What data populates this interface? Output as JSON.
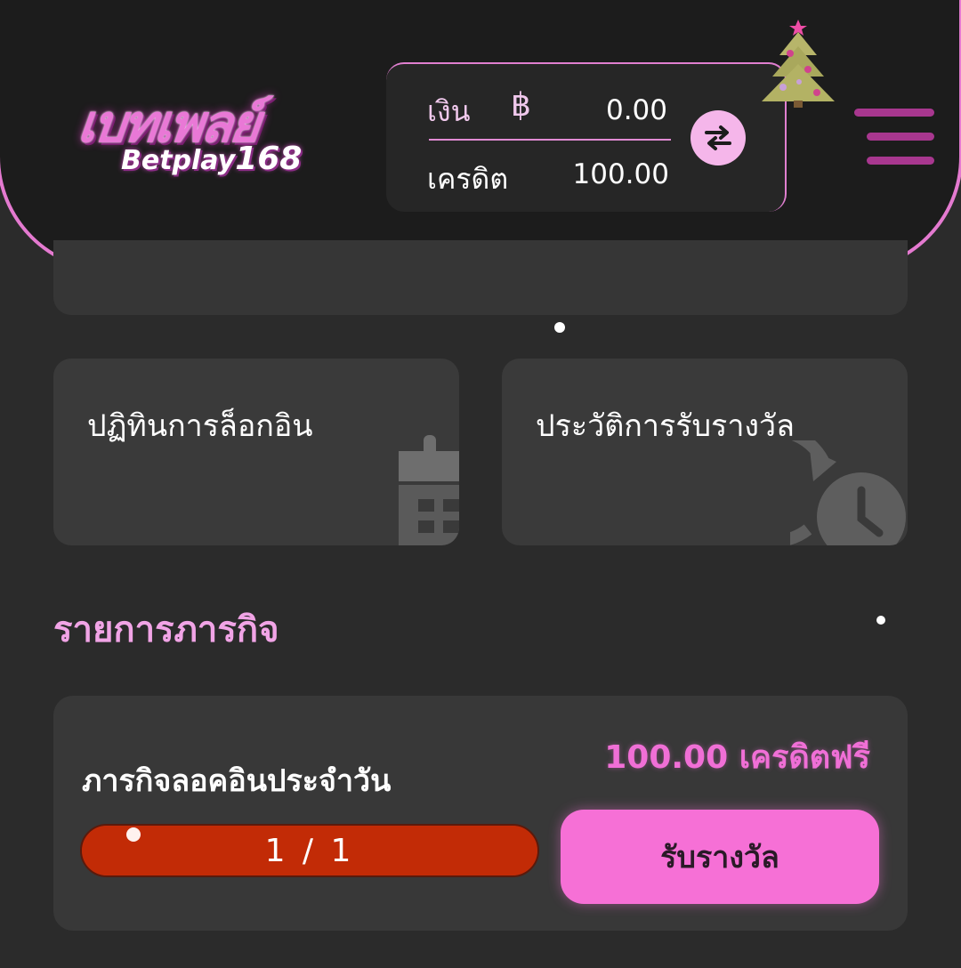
{
  "header": {
    "logo_thai": "เบทเพลย์",
    "logo_en": "Betplay",
    "logo_num": "168",
    "money_label": "เงิน",
    "currency_symbol": "฿",
    "money_value": "0.00",
    "credit_label": "เครดิต",
    "credit_value": "100.00",
    "accent_color": "#e47ad0"
  },
  "shortcuts": [
    {
      "label": "ปฏิทินการล็อกอิน",
      "icon": "calendar-icon"
    },
    {
      "label": "ประวัติการรับรางวัล",
      "icon": "history-clock-icon"
    }
  ],
  "missions": {
    "title": "รายการภารกิจ",
    "items": [
      {
        "name": "ภารกิจลอคอินประจำวัน",
        "reward": "100.00 เครดิตฟรี",
        "progress_text": "1 / 1",
        "progress_fraction": 1.0,
        "button_label": "รับรางวัล"
      }
    ]
  },
  "colors": {
    "progress": "#c22b06",
    "button": "#f670d6",
    "reward_text": "#f06fd6"
  }
}
